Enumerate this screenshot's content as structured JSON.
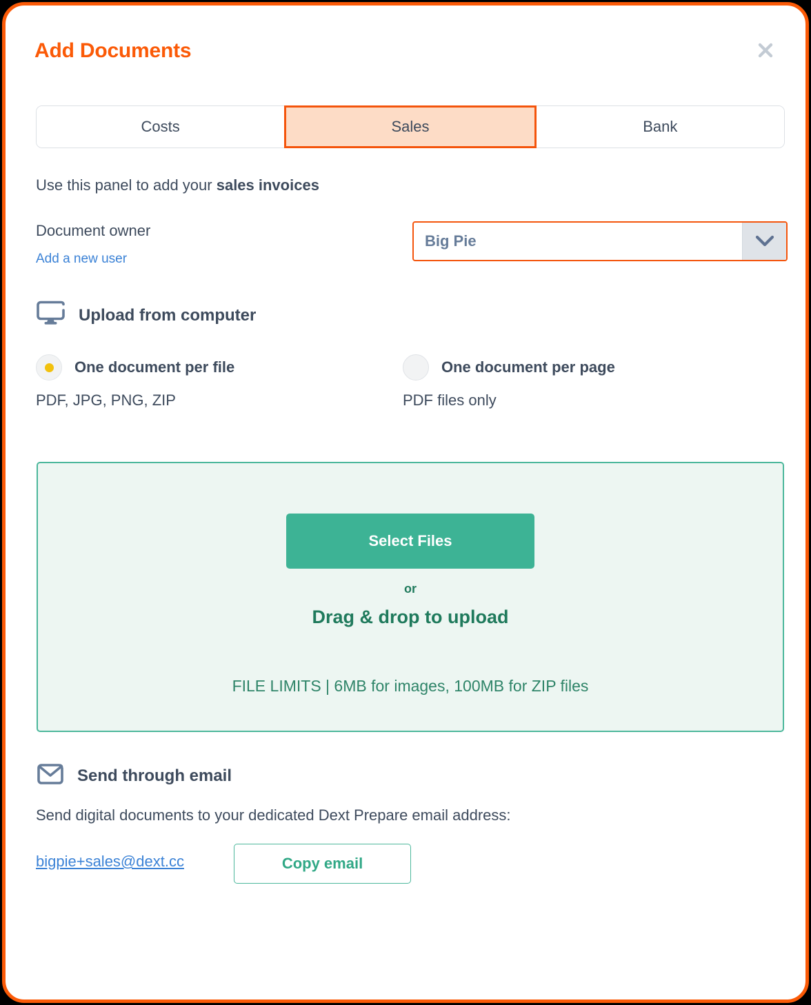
{
  "modal": {
    "title": "Add Documents",
    "close_icon": "close-icon",
    "accent_color": "#FB5A07",
    "border_color": "#FB5A07"
  },
  "tabs": {
    "items": [
      {
        "label": "Costs",
        "active": false
      },
      {
        "label": "Sales",
        "active": true
      },
      {
        "label": "Bank",
        "active": false
      }
    ],
    "active_bg": "#FDDCC6",
    "active_border": "#F4540B"
  },
  "intro": {
    "prefix": "Use this panel to add your ",
    "emphasis": "sales invoices"
  },
  "owner": {
    "label": "Document owner",
    "add_user_link": "Add a new user",
    "selected_value": "Big Pie",
    "options": [
      "Big Pie"
    ],
    "chevron_icon": "chevron-down-icon",
    "border_color": "#F4540B"
  },
  "upload": {
    "heading": "Upload from computer",
    "icon": "monitor-icon",
    "options": [
      {
        "label": "One document per file",
        "sub": "PDF, JPG, PNG, ZIP",
        "selected": true
      },
      {
        "label": "One document per page",
        "sub": "PDF files only",
        "selected": false
      }
    ],
    "radio_dot_color": "#F2C10D"
  },
  "dropzone": {
    "select_files_label": "Select Files",
    "or_label": "or",
    "drag_label": "Drag & drop to upload",
    "file_limits": "FILE LIMITS | 6MB for images, 100MB for ZIP files",
    "button_color": "#3DB395",
    "border_color": "#4BB79B",
    "bg_color": "#EDF6F2"
  },
  "email": {
    "heading": "Send through email",
    "icon": "envelope-icon",
    "description": "Send digital documents to your dedicated Dext Prepare email address:",
    "address": "bigpie+sales@dext.cc",
    "copy_label": "Copy email",
    "link_color": "#3B82D6",
    "button_border_color": "#4BB79B"
  }
}
